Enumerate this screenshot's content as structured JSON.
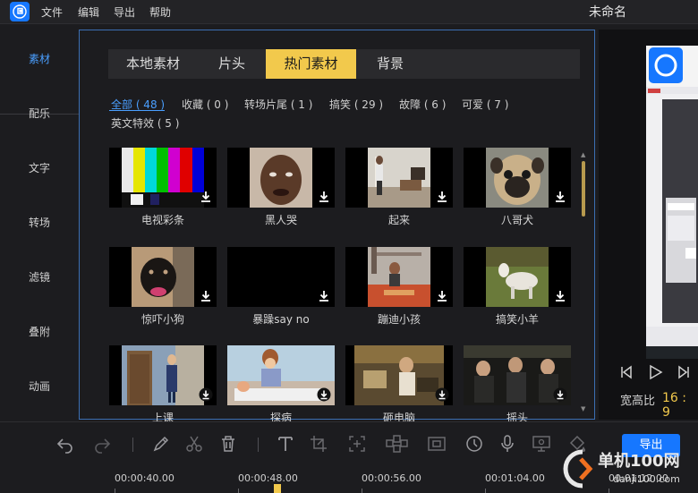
{
  "menu": [
    "文件",
    "编辑",
    "导出",
    "帮助"
  ],
  "doc_title": "未命名",
  "sidebar": [
    {
      "label": "素材",
      "active": true
    },
    {
      "label": "配乐"
    },
    {
      "label": "文字"
    },
    {
      "label": "转场"
    },
    {
      "label": "滤镜"
    },
    {
      "label": "叠附"
    },
    {
      "label": "动画"
    }
  ],
  "tabs": [
    {
      "label": "本地素材"
    },
    {
      "label": "片头"
    },
    {
      "label": "热门素材",
      "active": true
    },
    {
      "label": "背景"
    }
  ],
  "categories": [
    {
      "label": "全部 ( 48 )",
      "active": true
    },
    {
      "label": "收藏 ( 0 )"
    },
    {
      "label": "转场片尾 ( 1 )"
    },
    {
      "label": "搞笑 ( 29 )"
    },
    {
      "label": "故障 ( 6 )"
    },
    {
      "label": "可爱 ( 7 )"
    },
    {
      "label": "英文特效 ( 5 )"
    }
  ],
  "items": [
    {
      "label": "电视彩条",
      "thumb": "color-bars"
    },
    {
      "label": "黑人哭",
      "thumb": "man-crying"
    },
    {
      "label": "起来",
      "thumb": "room-person"
    },
    {
      "label": "八哥犬",
      "thumb": "pug"
    },
    {
      "label": "惊吓小狗",
      "thumb": "black-dog"
    },
    {
      "label": "暴躁say no",
      "thumb": "black"
    },
    {
      "label": "蹦迪小孩",
      "thumb": "dancing-kid"
    },
    {
      "label": "搞笑小羊",
      "thumb": "goat"
    },
    {
      "label": "上课",
      "thumb": "cartoon-class"
    },
    {
      "label": "探病",
      "thumb": "cartoon-bed"
    },
    {
      "label": "砸电脑",
      "thumb": "office"
    },
    {
      "label": "摇头",
      "thumb": "men-car"
    }
  ],
  "preview": {
    "ratio_label": "宽高比",
    "ratio_value": "16 : 9"
  },
  "toolbar": {
    "export_label": "导出"
  },
  "timeline": {
    "ticks": [
      "00:00:40.00",
      "00:00:48.00",
      "00:00:56.00",
      "00:01:04.00",
      "00:01:12.00"
    ]
  },
  "watermark": {
    "line1": "单机100网",
    "line2": "danji100.com"
  },
  "colors": {
    "accent": "#1677ff",
    "tab_active": "#f2c94c",
    "link_active": "#4a9fff"
  }
}
